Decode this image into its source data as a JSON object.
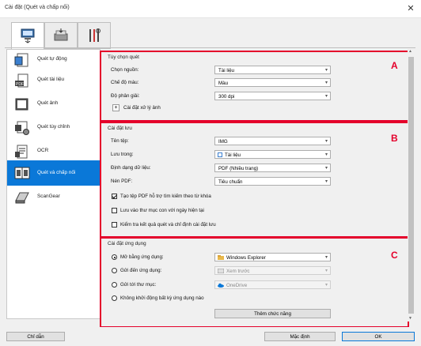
{
  "window": {
    "title": "Cài đặt (Quét và chấp nối)",
    "close_glyph": "✕"
  },
  "tabs": [
    {
      "icon": "scanner-from-computer-icon",
      "active": true
    },
    {
      "icon": "scanner-from-panel-icon",
      "active": false
    },
    {
      "icon": "general-settings-tools-icon",
      "active": false
    }
  ],
  "sidebar": {
    "items": [
      {
        "label": "Quét tự động",
        "icon": "auto-scan-icon"
      },
      {
        "label": "Quét tài liệu",
        "icon": "document-scan-icon"
      },
      {
        "label": "Quét ảnh",
        "icon": "photo-scan-icon"
      },
      {
        "label": "Quét tùy chỉnh",
        "icon": "custom-scan-icon"
      },
      {
        "label": "OCR",
        "icon": "ocr-icon"
      },
      {
        "label": "Quét và chấp nối",
        "icon": "scan-stitch-icon",
        "selected": true
      },
      {
        "label": "ScanGear",
        "icon": "scangear-icon"
      }
    ]
  },
  "section_a": {
    "letter": "A",
    "title": "Tùy chọn quét",
    "select_source_label": "Chọn nguồn:",
    "select_source_value": "Tài liệu",
    "color_mode_label": "Chế độ màu:",
    "color_mode_value": "Màu",
    "resolution_label": "Độ phân giải:",
    "resolution_value": "300 dpi",
    "image_processing_label": "Cài đặt xử lý ảnh",
    "plus_glyph": "+"
  },
  "section_b": {
    "letter": "B",
    "title": "Cài đặt lưu",
    "file_name_label": "Tên tệp:",
    "file_name_value": "IMG",
    "save_in_label": "Lưu trong:",
    "save_in_value": "Tài liệu",
    "data_format_label": "Định dạng dữ liệu:",
    "data_format_value": "PDF (Nhiều trang)",
    "pdf_compression_label": "Nén PDF:",
    "pdf_compression_value": "Tiêu chuẩn",
    "checkbox_searchable": "Tạo tệp PDF hỗ trợ tìm kiếm theo từ khóa",
    "checkbox_searchable_checked": true,
    "checkbox_subfolder": "Lưu vào thư mục con với ngày hiện tại",
    "checkbox_subfolder_checked": false,
    "checkbox_check_results": "Kiểm tra kết quả quét và chỉ định cài đặt lưu",
    "checkbox_check_results_checked": false
  },
  "section_c": {
    "letter": "C",
    "title": "Cài đặt ứng dụng",
    "open_with_app_label": "Mở bằng ứng dụng:",
    "open_with_app_value": "Windows Explorer",
    "send_to_app_label": "Gửi đến ứng dụng:",
    "send_to_app_value": "Xem trước",
    "send_to_folder_label": "Gửi tới thư mục:",
    "send_to_folder_value": "OneDrive",
    "no_app_label": "Không khởi động bất kỳ ứng dụng nào",
    "more_functions_label": "Thêm chức năng",
    "selected_option": "open_with_app"
  },
  "footer": {
    "instructions_label": "Chỉ dẫn",
    "defaults_label": "Mặc định",
    "ok_label": "OK"
  },
  "colors": {
    "accent": "#0a78d8",
    "highlight": "#e4002b"
  }
}
